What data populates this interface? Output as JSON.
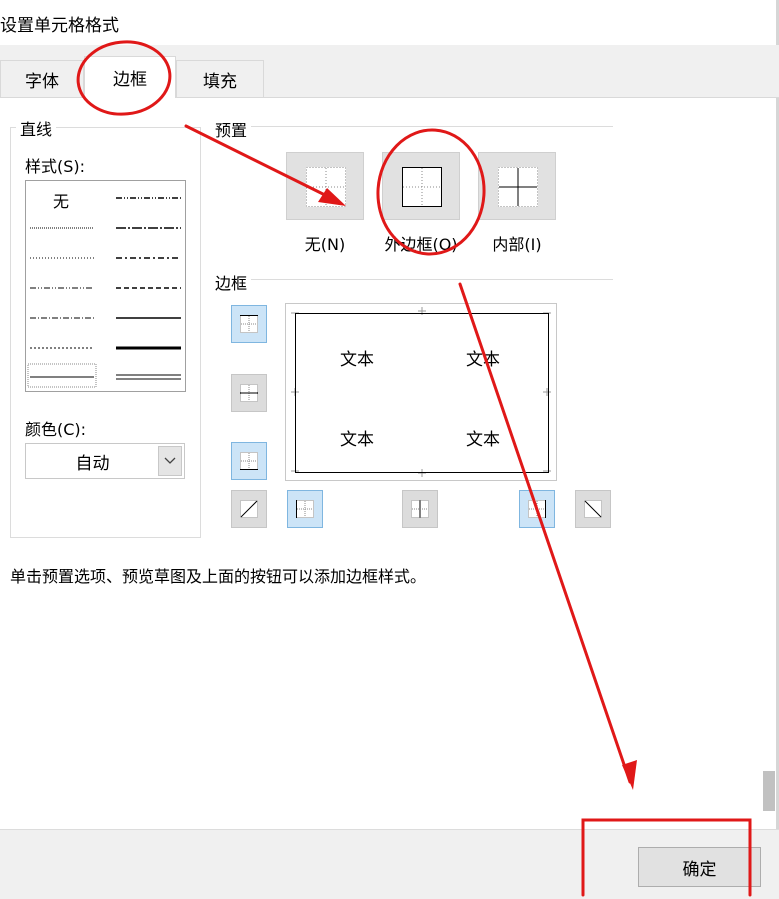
{
  "window": {
    "title": "设置单元格格式"
  },
  "tabs": [
    {
      "label": "字体",
      "active": false
    },
    {
      "label": "边框",
      "active": true
    },
    {
      "label": "填充",
      "active": false
    }
  ],
  "line_group": {
    "title": "直线",
    "style_label": "样式(S):",
    "style_none": "无",
    "color_label": "颜色(C):",
    "color_value": "自动"
  },
  "presets": {
    "title": "预置",
    "items": [
      {
        "label": "无(N)"
      },
      {
        "label": "外边框(O)"
      },
      {
        "label": "内部(I)"
      }
    ]
  },
  "border": {
    "title": "边框",
    "preview_text": [
      "文本",
      "文本",
      "文本",
      "文本"
    ]
  },
  "hint": "单击预置选项、预览草图及上面的按钮可以添加边框样式。",
  "footer": {
    "ok_label": "确定"
  },
  "colors": {
    "annotation": "#e01818",
    "selected_button": "#cce4f7",
    "dialog_bg": "#f0f0f0"
  }
}
